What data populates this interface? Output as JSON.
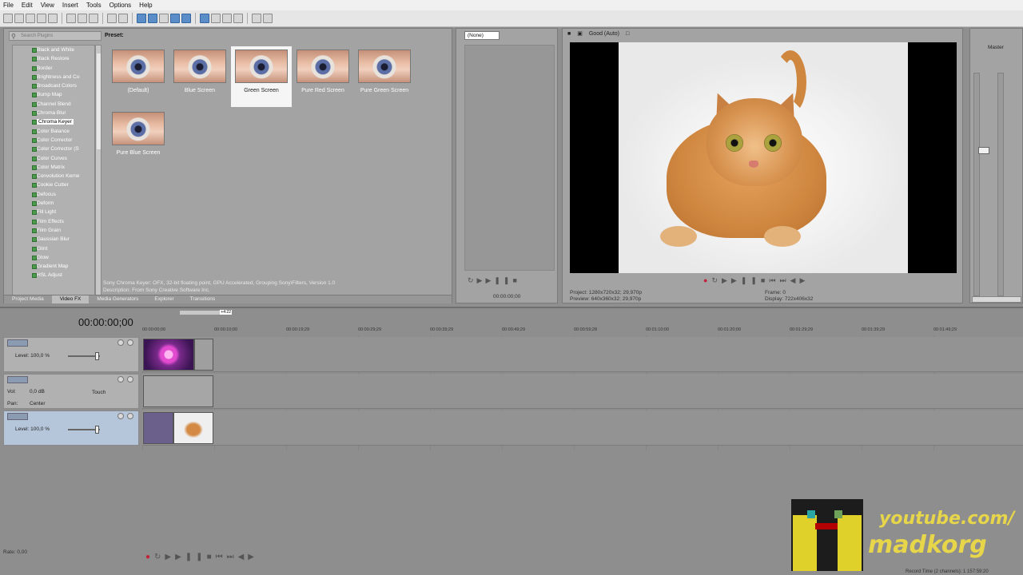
{
  "menu": [
    "File",
    "Edit",
    "View",
    "Insert",
    "Tools",
    "Options",
    "Help"
  ],
  "fx": {
    "search_placeholder": "Search Plugins",
    "preset_heading": "Preset:",
    "items": [
      "Black and White",
      "Black Restore",
      "Border",
      "Brightness and Co",
      "Broadcast Colors",
      "Bump Map",
      "Channel Blend",
      "Chroma Blur",
      "Chroma Keyer",
      "Color Balance",
      "Color Corrector",
      "Color Corrector (S",
      "Color Curves",
      "Color Matrix",
      "Convolution Kerne",
      "Cookie Cutter",
      "Defocus",
      "Deform",
      "Fill Light",
      "Film Effects",
      "Film Grain",
      "Gaussian Blur",
      "Glint",
      "Glow",
      "Gradient Map",
      "HSL Adjust"
    ],
    "selected_item": "Chroma Keyer",
    "presets": [
      "(Default)",
      "Blue Screen",
      "Green Screen",
      "Pure Red Screen",
      "Pure Green Screen",
      "Pure Blue Screen"
    ],
    "selected_preset": "Green Screen",
    "description_line1": "Sony Chroma Keyer: OFX, 32-bit floating point, GPU Accelerated, Grouping Sony\\Filters, Version 1.0",
    "description_line2": "Description: From Sony Creative Software Inc.",
    "tabs": [
      "Project Media",
      "Video FX",
      "Media Generators",
      "Explorer",
      "Transitions"
    ],
    "active_tab": "Video FX"
  },
  "trimmer": {
    "select_value": "(None)",
    "time": "00:00:00;00"
  },
  "preview": {
    "quality": "Good (Auto)",
    "project": "Project:  1280x720x32; 29,970p",
    "preview": "Preview:  640x360x32; 29,970p",
    "frame": "Frame:  0",
    "display": "Display:  722x406x32"
  },
  "master": {
    "title": "Master"
  },
  "timeline": {
    "timecode": "00:00:00;00",
    "loop_end": "+4:22",
    "ruler": [
      "00:00:00;00",
      "00:00:10;00",
      "00:00:19;29",
      "00:00:29;29",
      "00:00:39;29",
      "00:00:49;29",
      "00:00:59;28",
      "00:01:10;00",
      "00:01:20;00",
      "00:01:29;29",
      "00:01:39;29",
      "00:01:49;29"
    ],
    "track1_level": "Level: 100,0 %",
    "track2_vol": "Vol:",
    "track2_vol_value": "0,0 dB",
    "track2_touch": "Touch",
    "track2_pan": "Pan:",
    "track2_pan_value": "Center",
    "track3_level": "Level: 100,0 %",
    "rate": "Rate: 0,00",
    "record_time": "Record Time (2 channels): 1 157:59:20"
  },
  "brand": {
    "line1": "youtube.com/",
    "line2": "madkorg"
  }
}
